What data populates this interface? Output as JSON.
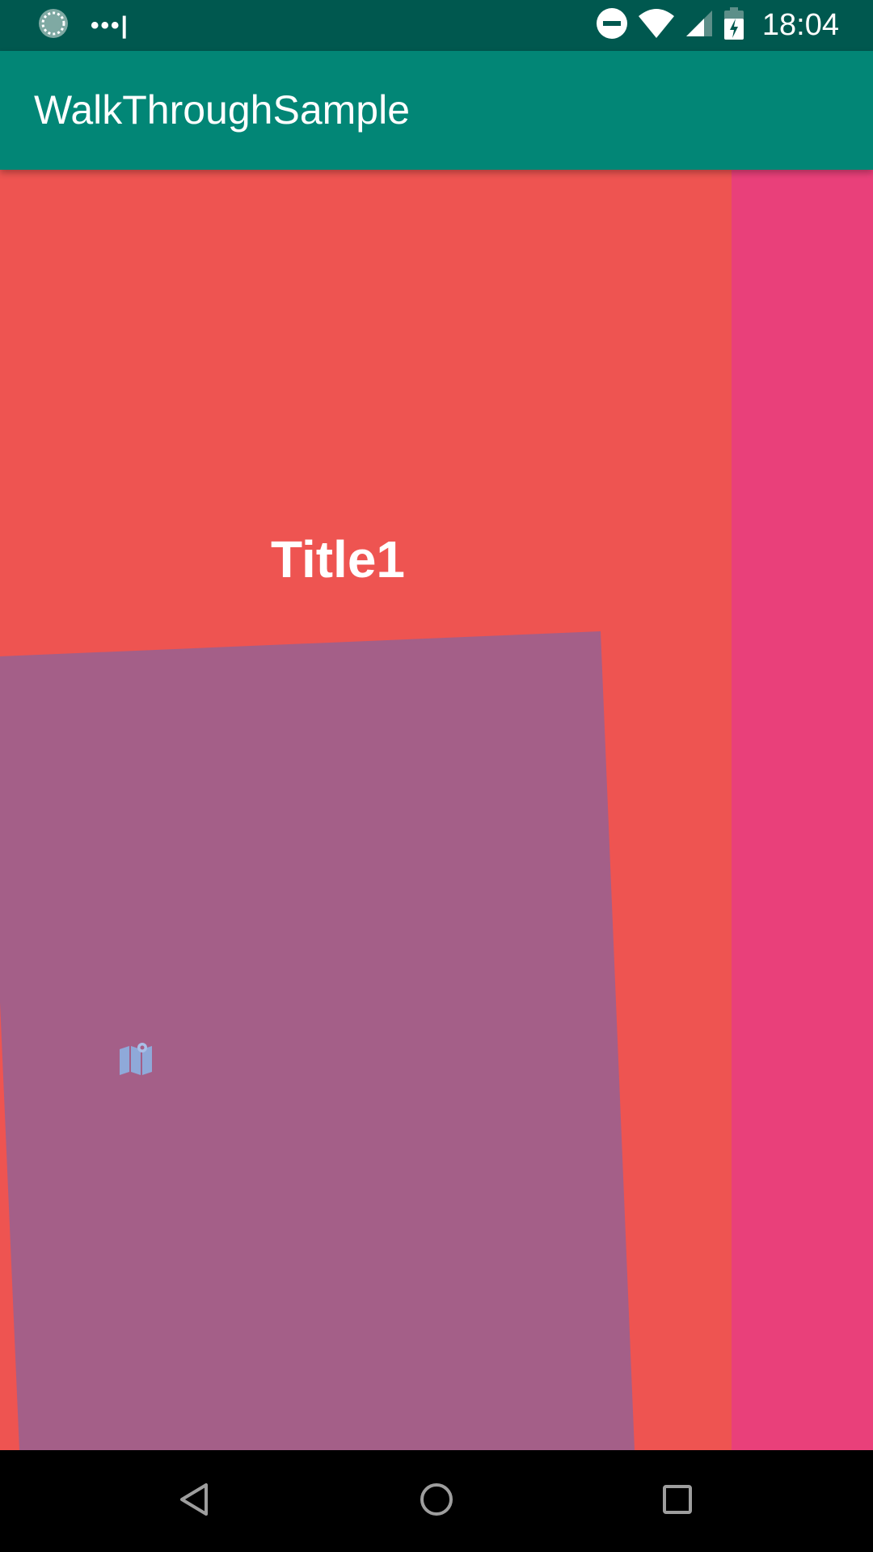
{
  "status_bar": {
    "time": "18:04",
    "icons": [
      "loading-icon",
      "more-dots-icon",
      "do-not-disturb-icon",
      "wifi-icon",
      "cellular-signal-icon",
      "battery-charging-icon"
    ],
    "dots": "•••|"
  },
  "app_bar": {
    "title": "WalkThroughSample"
  },
  "walkthrough": {
    "current_page": {
      "title": "Title1",
      "background_color": "#ee5451",
      "card_color": "#a45f88",
      "icon": "map-icon"
    },
    "next_page": {
      "background_color": "#e9407a"
    }
  },
  "nav_bar": {
    "buttons": [
      "back-icon",
      "home-icon",
      "recents-icon"
    ]
  },
  "colors": {
    "status_bar": "#00584f",
    "app_bar": "#028676",
    "nav_bar": "#000000"
  }
}
